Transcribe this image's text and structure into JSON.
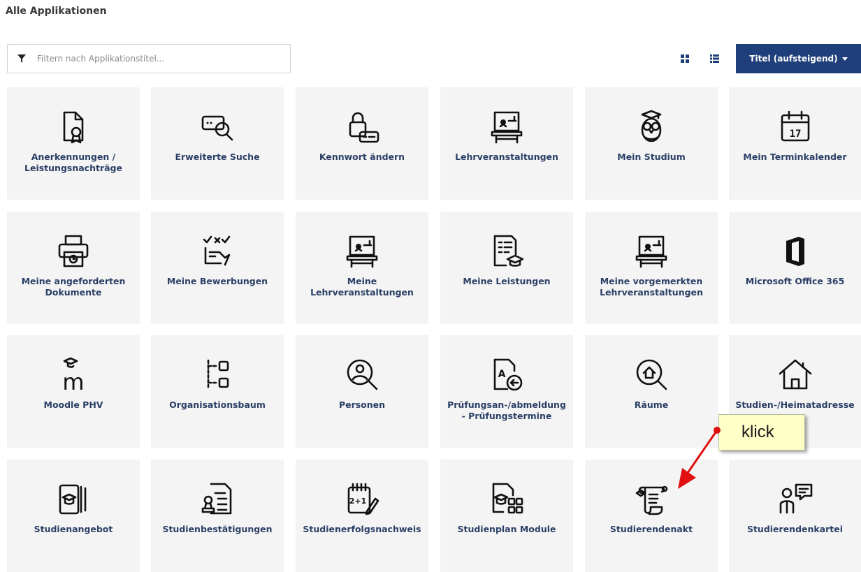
{
  "page": {
    "title": "Alle Applikationen"
  },
  "filter": {
    "placeholder": "Filtern nach Applikationstitel..."
  },
  "toolbar": {
    "grid_view_icon": "grid-icon",
    "list_view_icon": "list-icon",
    "sort_label": "Titel (aufsteigend)",
    "accent_color": "#1f3f7a"
  },
  "tiles": [
    {
      "label": "Anerkennungen /\nLeistungsnachträge",
      "icon": "certificate-document-icon"
    },
    {
      "label": "Erweiterte Suche",
      "icon": "advanced-search-icon"
    },
    {
      "label": "Kennwort ändern",
      "icon": "lock-password-icon"
    },
    {
      "label": "Lehrveranstaltungen",
      "icon": "lecture-board-icon"
    },
    {
      "label": "Mein Studium",
      "icon": "owl-graduate-icon"
    },
    {
      "label": "Mein Terminkalender",
      "icon": "calendar-icon"
    },
    {
      "label": "Meine angeforderten\nDokumente",
      "icon": "printer-document-icon"
    },
    {
      "label": "Meine Bewerbungen",
      "icon": "application-hand-icon"
    },
    {
      "label": "Meine\nLehrveranstaltungen",
      "icon": "lecture-board-icon"
    },
    {
      "label": "Meine Leistungen",
      "icon": "grades-document-icon"
    },
    {
      "label": "Meine vorgemerkten\nLehrveranstaltungen",
      "icon": "lecture-board-icon"
    },
    {
      "label": "Microsoft Office 365",
      "icon": "office-365-icon"
    },
    {
      "label": "Moodle PHV",
      "icon": "moodle-icon"
    },
    {
      "label": "Organisationsbaum",
      "icon": "org-tree-icon"
    },
    {
      "label": "Personen",
      "icon": "person-search-icon"
    },
    {
      "label": "Prüfungsan-/abmeldung\n- Prüfungstermine",
      "icon": "exam-registration-icon"
    },
    {
      "label": "Räume",
      "icon": "room-search-icon"
    },
    {
      "label": "Studien-/Heimatadresse",
      "icon": "home-icon"
    },
    {
      "label": "Studienangebot",
      "icon": "study-catalog-icon"
    },
    {
      "label": "Studienbestätigungen",
      "icon": "confirmation-stamp-icon"
    },
    {
      "label": "Studienerfolgsnachweis",
      "icon": "study-success-icon"
    },
    {
      "label": "Studienplan Module",
      "icon": "study-plan-modules-icon"
    },
    {
      "label": "Studierendenakt",
      "icon": "scroll-file-icon"
    },
    {
      "label": "Studierendenkartei",
      "icon": "person-chat-icon"
    }
  ],
  "annotation": {
    "text": "klick",
    "color": "#e01010"
  }
}
